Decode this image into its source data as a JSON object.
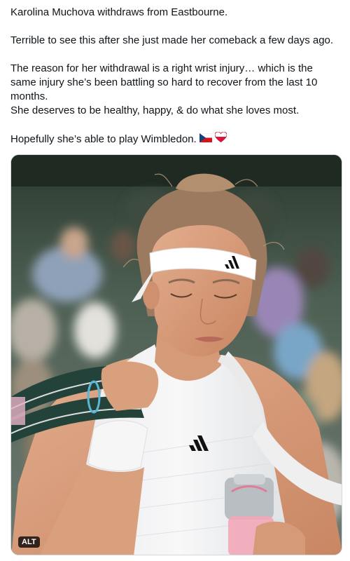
{
  "post": {
    "paragraphs": [
      "Karolina Muchova withdraws from Eastbourne.",
      "Terrible to see this after she just made her comeback a few days ago.",
      "The reason for her withdrawal is a right wrist injury… which is the same injury she’s been battling so hard to recover from the last 10 months.",
      "She deserves to be healthy, happy, & do what she loves most.",
      "Hopefully she’s able to play Wimbledon."
    ],
    "emojis": [
      "czech-flag-emoji",
      "heart-emoji"
    ]
  },
  "media": {
    "alt_label": "ALT",
    "colors": {
      "headband": "#ffffff",
      "skin": "#d9a07e",
      "hair": "#a8866a",
      "bag_strap": "#23433a",
      "bottle_liquid": "#f2a7b8",
      "background_blur": "#4a5a4a"
    }
  }
}
